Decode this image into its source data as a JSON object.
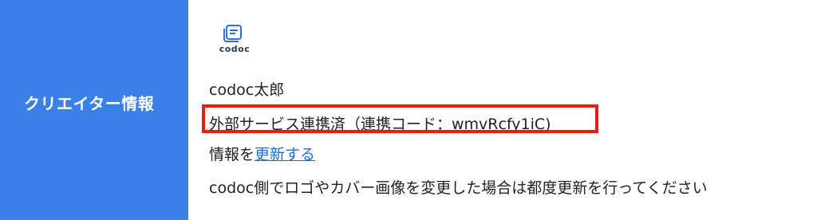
{
  "sidebar": {
    "label": "クリエイター情報",
    "background": "#3a80e8"
  },
  "logo": {
    "icon": "codoc-logo-icon",
    "text": "codoc"
  },
  "creator": {
    "name": "codoc太郎",
    "link_status": "外部サービス連携済（連携コード：wmvRcfy1iC)",
    "update_prefix": "情報を",
    "update_link": "更新する",
    "note": "codoc側でロゴやカバー画像を変更した場合は都度更新を行ってください"
  },
  "colors": {
    "highlight": "#ec1c0f",
    "link": "#1a6fd6"
  }
}
